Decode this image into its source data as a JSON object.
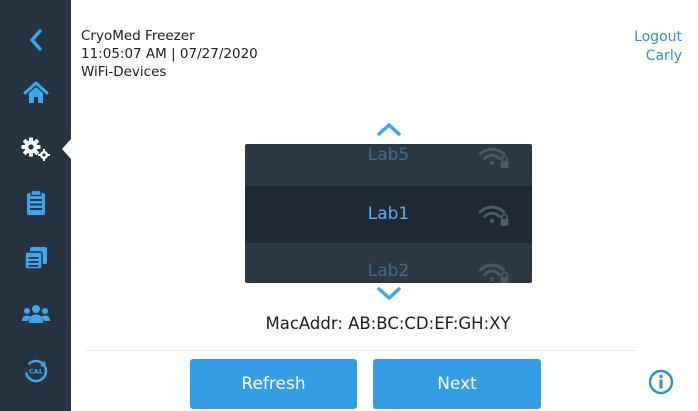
{
  "header": {
    "device_name": "CryoMed Freezer",
    "datetime": "11:05:07 AM | 07/27/2020",
    "screen_title": "WiFi-Devices"
  },
  "user": {
    "logout_label": "Logout",
    "username": "Carly"
  },
  "sidebar": {
    "items": [
      {
        "icon": "back-chevron-icon"
      },
      {
        "icon": "home-icon"
      },
      {
        "icon": "settings-gears-icon",
        "active": true
      },
      {
        "icon": "clipboard-icon"
      },
      {
        "icon": "calendar-list-icon"
      },
      {
        "icon": "users-group-icon"
      },
      {
        "icon": "calibration-icon",
        "text": "CAL"
      }
    ]
  },
  "picker": {
    "items": [
      {
        "name": "Lab5",
        "secured": true
      },
      {
        "name": "Lab1",
        "secured": true,
        "selected": true
      },
      {
        "name": "Lab2",
        "secured": true
      }
    ]
  },
  "mac_address": "MacAddr: AB:BC:CD:EF:GH:XY",
  "buttons": {
    "refresh": "Refresh",
    "next": "Next"
  },
  "colors": {
    "sidebar_bg": "#263442",
    "accent": "#359de3",
    "link": "#2e8fd4",
    "picker_bg": "#2c3843",
    "picker_selected_bg": "#1f2a34"
  }
}
